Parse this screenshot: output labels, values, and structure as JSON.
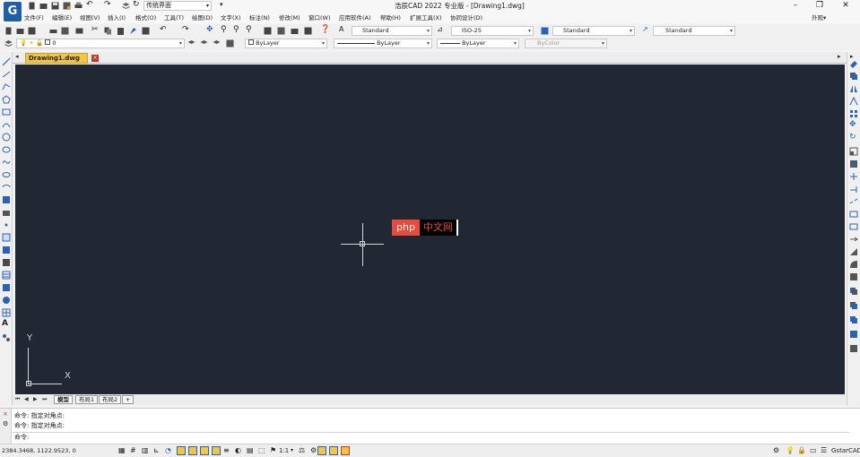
{
  "window": {
    "title": "浩辰CAD 2022 专业版 - [Drawing1.dwg]",
    "workspace": "传统界面",
    "appearance_label": "外观"
  },
  "menu": [
    "文件(F)",
    "编辑(E)",
    "视图(V)",
    "插入(I)",
    "格式(O)",
    "工具(T)",
    "绘图(D)",
    "文字(X)",
    "标注(N)",
    "修改(M)",
    "窗口(W)",
    "应用软件(A)",
    "帮助(H)",
    "扩展工具(X)",
    "协同设计(D)"
  ],
  "toolbar": {
    "text_style": "Standard",
    "dim_style": "ISO-25",
    "table_style": "Standard",
    "multileader_style": "Standard",
    "layer": "0",
    "color": "ByLayer",
    "linetype": "ByLayer",
    "lineweight": "ByLayer",
    "plot_style": "ByColor"
  },
  "document": {
    "tab_label": "Drawing1.dwg"
  },
  "canvas": {
    "background": "#222833",
    "watermark_left": "php",
    "watermark_right": "中文网",
    "ucs_x": "X",
    "ucs_y": "Y"
  },
  "layout_tabs": [
    "模型",
    "布局1",
    "布局2",
    "+"
  ],
  "command": {
    "lines": [
      "命令: 指定对角点:",
      "命令: 指定对角点:"
    ],
    "prompt": "命令:"
  },
  "status": {
    "coordinates": "2384.3468, 1122.9523, 0",
    "scale": "1:1",
    "brand": "GstarCAD"
  },
  "colors": {
    "accent": "#1e5fa8",
    "doc_tab": "#f4c542",
    "watermark_red": "#e64b3c"
  }
}
